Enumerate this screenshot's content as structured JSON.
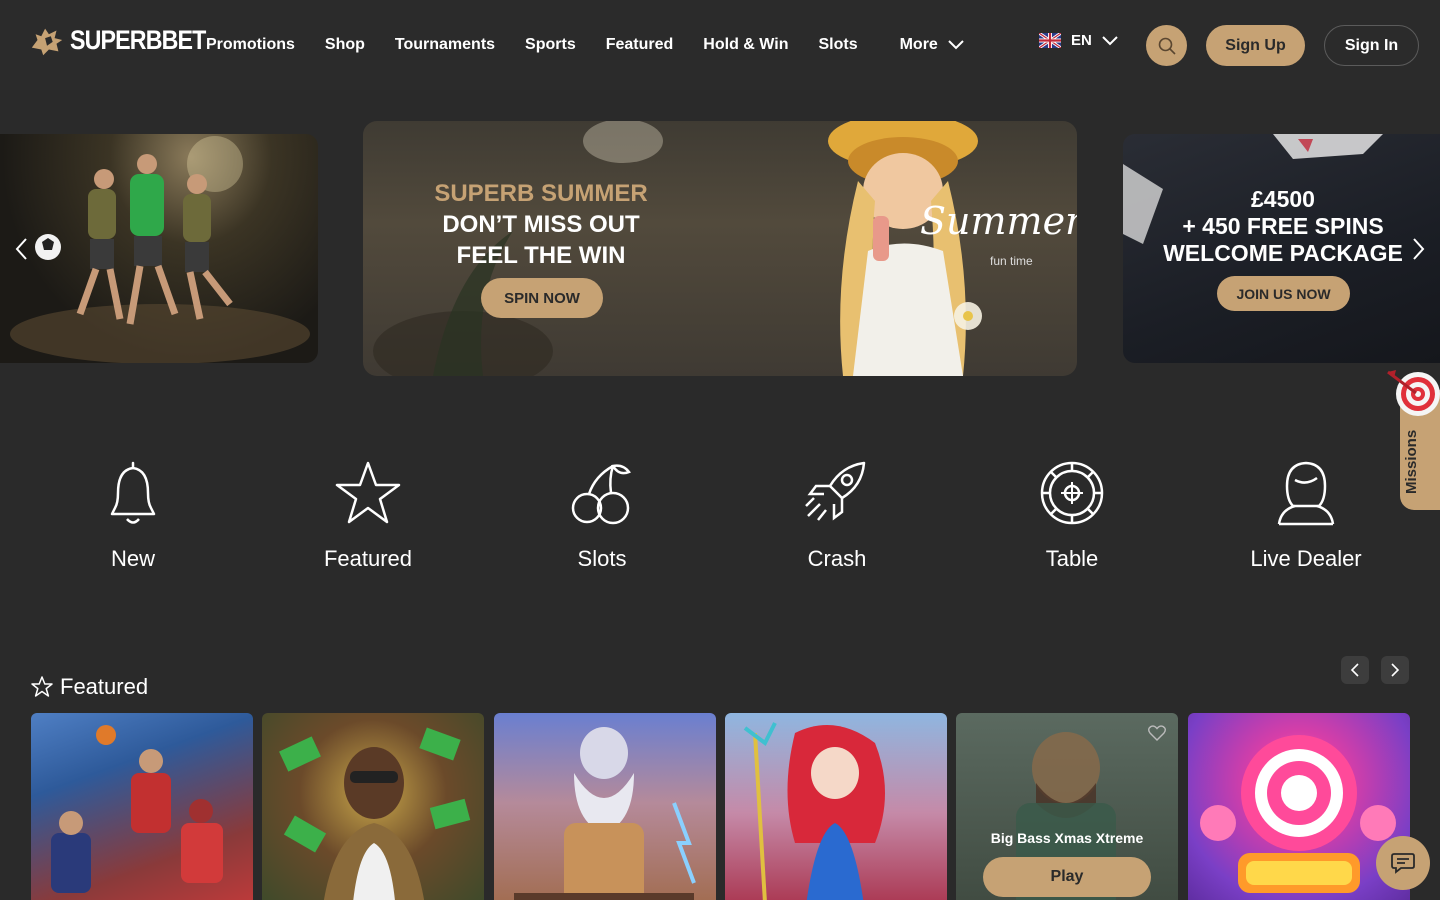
{
  "header": {
    "logo_text": "SUPERBBET",
    "nav": [
      "Promotions",
      "Shop",
      "Tournaments",
      "Sports",
      "Featured",
      "Hold & Win",
      "Slots"
    ],
    "more_label": "More",
    "language": "EN",
    "signup_label": "Sign Up",
    "signin_label": "Sign In"
  },
  "carousel": {
    "center": {
      "line1": "SUPERB SUMMER",
      "line2": "DON’T MISS OUT",
      "line3": "FEEL THE WIN",
      "button": "SPIN NOW",
      "script_text": "Summer",
      "script_sub": "fun time"
    },
    "right": {
      "line1": "£4500",
      "line2": "+ 450 FREE SPINS",
      "line3": "WELCOME PACKAGE",
      "button": "JOIN US NOW"
    }
  },
  "missions_label": "Missions",
  "categories": [
    "New",
    "Featured",
    "Slots",
    "Crash",
    "Table",
    "Live Dealer"
  ],
  "featured": {
    "title": "Featured",
    "hover_tile": {
      "title": "Big Bass Xmas Xtreme",
      "play_label": "Play"
    }
  },
  "colors": {
    "accent": "#c6a274",
    "background": "#2a2a2a"
  }
}
